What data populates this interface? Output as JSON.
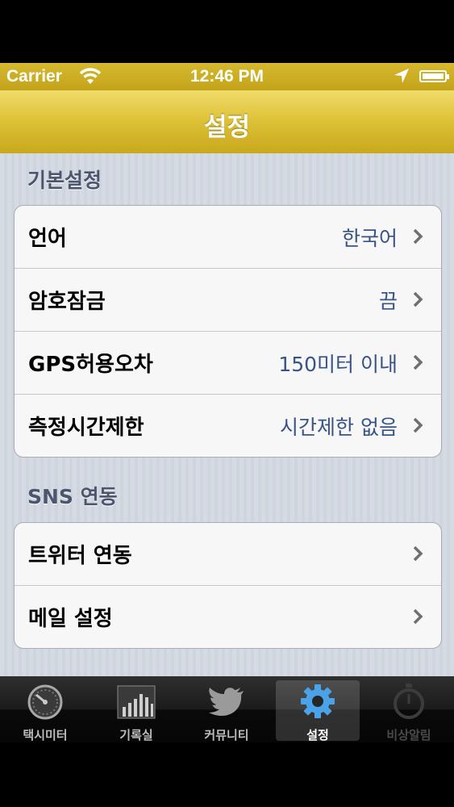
{
  "status_bar": {
    "carrier": "Carrier",
    "time": "12:46 PM"
  },
  "nav": {
    "title": "설정"
  },
  "sections": {
    "basic": {
      "header": "기본설정",
      "rows": [
        {
          "label": "언어",
          "value": "한국어"
        },
        {
          "label": "암호잠금",
          "value": "끔"
        },
        {
          "label": "GPS허용오차",
          "value": "150미터 이내"
        },
        {
          "label": "측정시간제한",
          "value": "시간제한 없음"
        }
      ]
    },
    "sns": {
      "header": "SNS 연동",
      "rows": [
        {
          "label": "트위터 연동"
        },
        {
          "label": "메일 설정"
        }
      ]
    }
  },
  "tabs": [
    {
      "label": "택시미터",
      "icon": "speedometer-icon"
    },
    {
      "label": "기록실",
      "icon": "bar-chart-icon"
    },
    {
      "label": "커뮤니티",
      "icon": "twitter-bird-icon"
    },
    {
      "label": "설정",
      "icon": "gear-icon",
      "selected": true
    },
    {
      "label": "비상알림",
      "icon": "stopwatch-icon",
      "disabled": true
    }
  ],
  "colors": {
    "nav_gold": "#d6b92e",
    "value_blue": "#385487",
    "section_text": "#4c566c"
  }
}
